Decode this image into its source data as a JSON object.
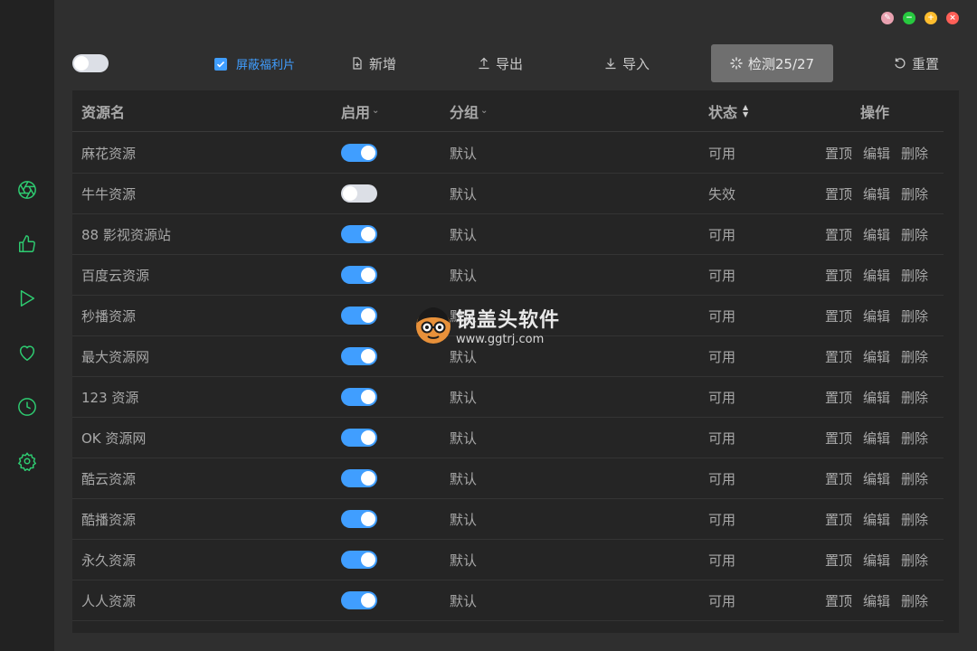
{
  "window": {
    "controls": [
      {
        "name": "pin",
        "color": "#e9a1b0",
        "glyph": "✎"
      },
      {
        "name": "minimize",
        "color": "#27c93f",
        "glyph": "−"
      },
      {
        "name": "maximize",
        "color": "#ffbd2e",
        "glyph": "+"
      },
      {
        "name": "close",
        "color": "#ff5f57",
        "glyph": "×"
      }
    ]
  },
  "sidebar": {
    "accent": "#2ecc71",
    "items": [
      {
        "icon": "aperture-icon"
      },
      {
        "icon": "thumbs-up-icon"
      },
      {
        "icon": "play-icon"
      },
      {
        "icon": "heart-icon"
      },
      {
        "icon": "clock-icon"
      },
      {
        "icon": "gear-icon"
      }
    ]
  },
  "toolbar": {
    "main_toggle_on": false,
    "checkbox_checked": true,
    "checkbox_label": "屏蔽福利片",
    "add_label": "新增",
    "export_label": "导出",
    "import_label": "导入",
    "check_label": "检测25/27",
    "reset_label": "重置"
  },
  "table": {
    "headers": {
      "name": "资源名",
      "enable": "启用",
      "group": "分组",
      "status": "状态",
      "ops": "操作"
    },
    "op_labels": {
      "top": "置顶",
      "edit": "编辑",
      "delete": "删除"
    },
    "rows": [
      {
        "name": "麻花资源",
        "enabled": true,
        "group": "默认",
        "status": "可用"
      },
      {
        "name": "牛牛资源",
        "enabled": false,
        "group": "默认",
        "status": "失效"
      },
      {
        "name": "88 影视资源站",
        "enabled": true,
        "group": "默认",
        "status": "可用"
      },
      {
        "name": "百度云资源",
        "enabled": true,
        "group": "默认",
        "status": "可用"
      },
      {
        "name": "秒播资源",
        "enabled": true,
        "group": "默认",
        "status": "可用"
      },
      {
        "name": "最大资源网",
        "enabled": true,
        "group": "默认",
        "status": "可用"
      },
      {
        "name": "123 资源",
        "enabled": true,
        "group": "默认",
        "status": "可用"
      },
      {
        "name": "OK 资源网",
        "enabled": true,
        "group": "默认",
        "status": "可用"
      },
      {
        "name": "酷云资源",
        "enabled": true,
        "group": "默认",
        "status": "可用"
      },
      {
        "name": "酷播资源",
        "enabled": true,
        "group": "默认",
        "status": "可用"
      },
      {
        "name": "永久资源",
        "enabled": true,
        "group": "默认",
        "status": "可用"
      },
      {
        "name": "人人资源",
        "enabled": true,
        "group": "默认",
        "status": "可用"
      }
    ]
  },
  "watermark": {
    "title": "锅盖头软件",
    "url": "www.ggtrj.com"
  }
}
